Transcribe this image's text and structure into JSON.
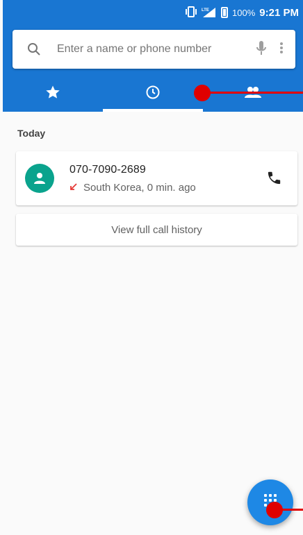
{
  "status_bar": {
    "battery_percent": "100%",
    "time": "9:21 PM"
  },
  "search": {
    "placeholder": "Enter a name or phone number"
  },
  "tabs": [
    {
      "icon": "star-icon"
    },
    {
      "icon": "clock-icon",
      "selected": true
    },
    {
      "icon": "contacts-icon"
    }
  ],
  "content": {
    "section_title": "Today",
    "call": {
      "number": "070-7090-2689",
      "detail": "South Korea, 0 min. ago"
    },
    "history_button": "View full call history"
  },
  "fab": {
    "icon": "dialpad-icon"
  },
  "colors": {
    "primary": "#1976d2",
    "avatar": "#0aa38d",
    "fab": "#1e88e5",
    "missed_call": "#e53935",
    "annotation": "#e00000"
  }
}
